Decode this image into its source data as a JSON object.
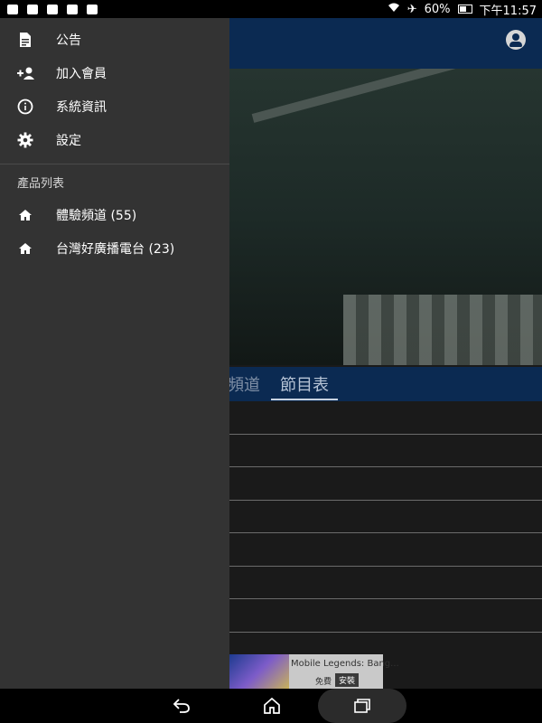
{
  "status_bar": {
    "battery": "60%",
    "time": "下午11:57"
  },
  "drawer": {
    "items": [
      {
        "label": "公告",
        "icon": "document-icon"
      },
      {
        "label": "加入會員",
        "icon": "add-person-icon"
      },
      {
        "label": "系統資訊",
        "icon": "info-icon"
      },
      {
        "label": "設定",
        "icon": "gear-icon"
      }
    ],
    "section_header": "產品列表",
    "products": [
      {
        "label": "體驗頻道 (55)",
        "icon": "home-icon"
      },
      {
        "label": "台灣好廣播電台 (23)",
        "icon": "home-icon"
      }
    ]
  },
  "main": {
    "tabs": [
      "頻道",
      "節目表"
    ],
    "active_tab": 1
  },
  "ad": {
    "title": "Mobile Legends: Bang...",
    "free_label": "免費",
    "install_label": "安裝"
  },
  "colors": {
    "drawer_bg": "#333333",
    "appbar": "#0b2a52",
    "list_bg": "#1a1a1a"
  }
}
